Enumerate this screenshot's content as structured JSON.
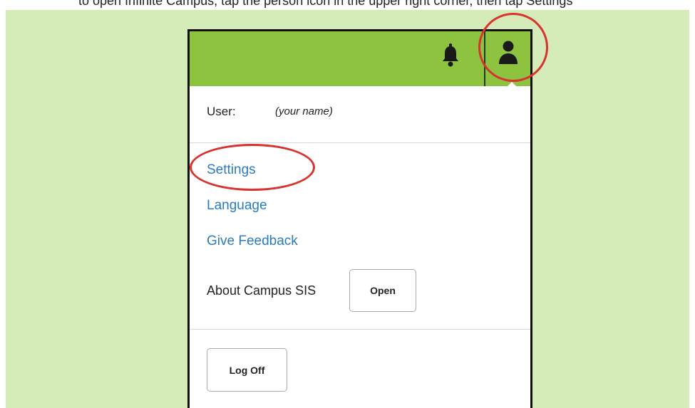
{
  "instruction_text": "to open Infinite Campus, tap the person icon in the upper right corner, then tap Settings",
  "header": {
    "bell_icon": "bell-icon",
    "user_icon": "user-icon",
    "accent_color": "#8dc33f"
  },
  "user_menu": {
    "user_label": "User:",
    "user_value": "(your name)",
    "links": {
      "settings": "Settings",
      "language": "Language",
      "feedback": "Give Feedback"
    },
    "about_label": "About Campus SIS",
    "open_button": "Open",
    "logoff_button": "Log Off",
    "link_color": "#2b7bbf"
  },
  "annotations": {
    "highlight_color": "#d9332f"
  }
}
